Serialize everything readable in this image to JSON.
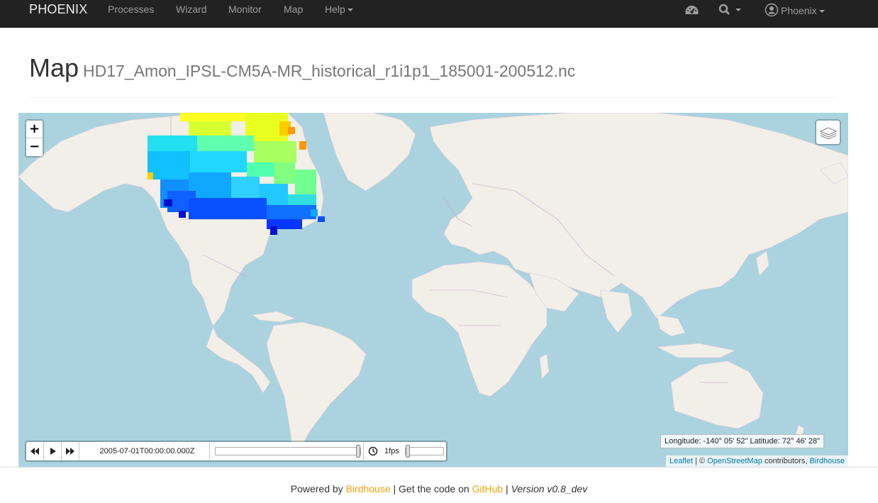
{
  "navbar": {
    "brand": "PHOENIX",
    "items": [
      "Processes",
      "Wizard",
      "Monitor",
      "Map",
      "Help"
    ],
    "user": "Phoenix"
  },
  "page": {
    "title": "Map",
    "subtitle": "HD17_Amon_IPSL-CM5A-MR_historical_r1i1p1_185001-200512.nc"
  },
  "map": {
    "zoom_in": "+",
    "zoom_out": "−",
    "coordinates": "Longitude: -140° 05' 52\" Latitude: 72° 46' 28\"",
    "attribution": {
      "leaflet": "Leaflet",
      "sep": " | © ",
      "osm": "OpenStreetMap",
      "contrib": " contributors, ",
      "birdhouse": "Birdhouse"
    },
    "time": {
      "current": "2005-07-01T00:00:00.000Z",
      "fps": "1fps",
      "position": 1.0
    },
    "colors": {
      "ocean": "#aad3df",
      "land": "#f2efe9",
      "borders": "#c8a0c8"
    }
  },
  "footer": {
    "powered": "Powered by ",
    "birdhouse": "Birdhouse",
    "code": " | Get the code on ",
    "github": "GitHub",
    "sep": " | ",
    "version": "Version v0.8_dev"
  }
}
